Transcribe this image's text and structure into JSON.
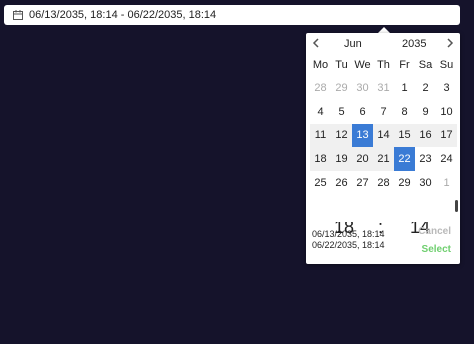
{
  "input": {
    "value": "06/13/2035, 18:14 - 06/22/2035, 18:14",
    "icon": "calendar-icon"
  },
  "picker": {
    "month": "Jun",
    "year": "2035",
    "weekdays": [
      "Mo",
      "Tu",
      "We",
      "Th",
      "Fr",
      "Sa",
      "Su"
    ],
    "weeks": [
      [
        "28",
        "29",
        "30",
        "31",
        "1",
        "2",
        "3"
      ],
      [
        "4",
        "5",
        "6",
        "7",
        "8",
        "9",
        "10"
      ],
      [
        "11",
        "12",
        "13",
        "14",
        "15",
        "16",
        "17"
      ],
      [
        "18",
        "19",
        "20",
        "21",
        "22",
        "23",
        "24"
      ],
      [
        "25",
        "26",
        "27",
        "28",
        "29",
        "30",
        "1"
      ]
    ],
    "time": {
      "hour": "18",
      "sep": ":",
      "minute": "14"
    },
    "summary": [
      "06/13/2035, 18:14",
      "06/22/2035, 18:14"
    ],
    "cancel_label": "Cancel",
    "select_label": "Select"
  }
}
